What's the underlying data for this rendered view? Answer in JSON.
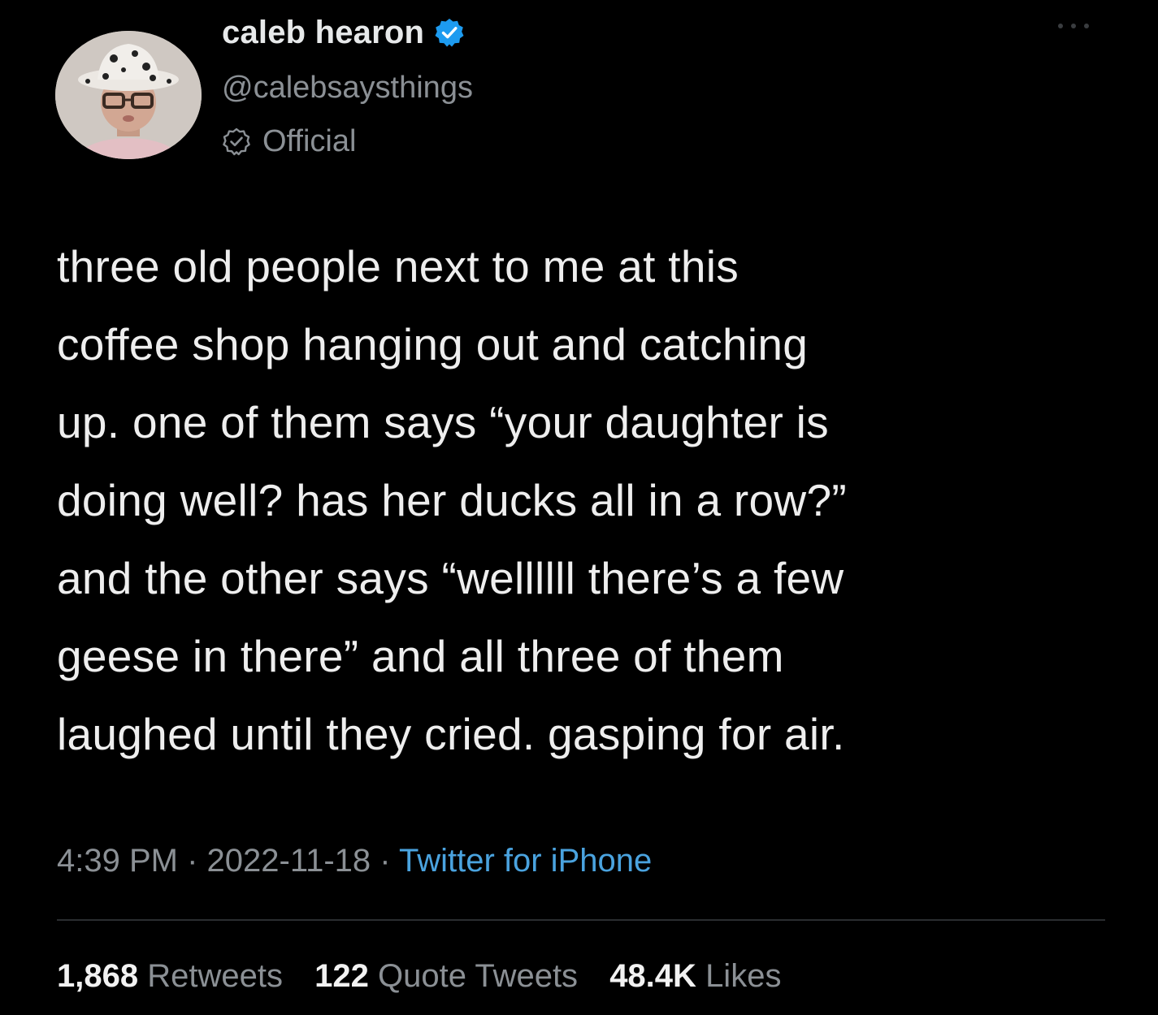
{
  "author": {
    "display_name": "caleb hearon",
    "handle": "@calebsaysthings",
    "label": "Official",
    "avatar_icon": "profile-photo",
    "verified_icon": "verified-badge-icon",
    "official_icon": "official-badge-icon"
  },
  "tweet": {
    "text": "three old people next to me at this\ncoffee shop hanging out and catching\nup. one of them says “your daughter is\ndoing well? has her ducks all in a row?”\nand the other says “wellllll there’s a few\ngeese in there” and all three of them\nlaughed until they cried. gasping for air."
  },
  "meta": {
    "time": "4:39 PM",
    "separator": " · ",
    "date": "2022-11-18",
    "source": "Twitter for iPhone"
  },
  "stats": {
    "retweets_count": "1,868",
    "retweets_label": "Retweets",
    "quotes_count": "122",
    "quotes_label": "Quote Tweets",
    "likes_count": "48.4K",
    "likes_label": "Likes"
  },
  "colors": {
    "background": "#000000",
    "text": "#e7e9ea",
    "secondary": "#8b9095",
    "accent": "#4aa3df",
    "verified": "#1d9bf0"
  }
}
